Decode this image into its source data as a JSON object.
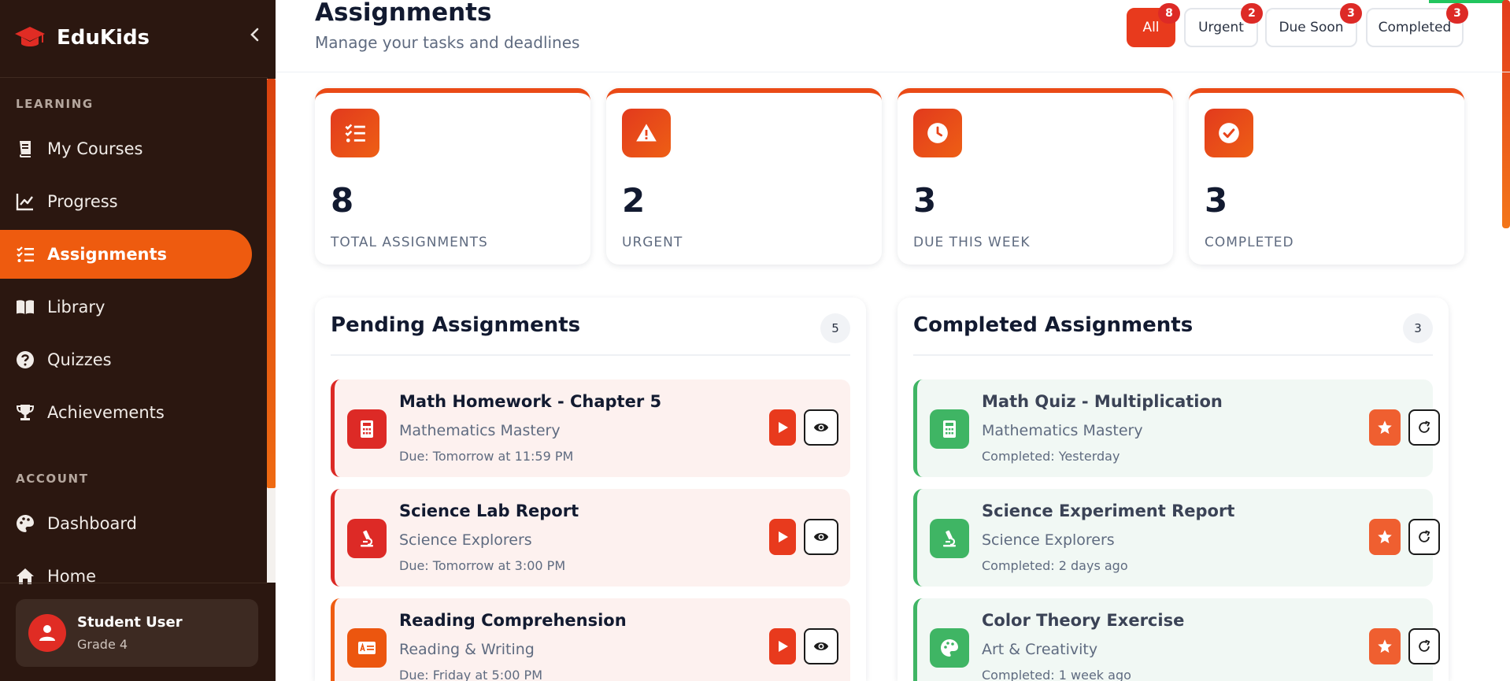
{
  "sidebar": {
    "brand": "EduKids",
    "sections": {
      "learning": "LEARNING",
      "account": "ACCOUNT"
    },
    "items": [
      {
        "label": "My Courses",
        "icon": "book-icon"
      },
      {
        "label": "Progress",
        "icon": "chart-line-icon"
      },
      {
        "label": "Assignments",
        "icon": "tasks-icon",
        "active": true
      },
      {
        "label": "Library",
        "icon": "open-book-icon"
      },
      {
        "label": "Quizzes",
        "icon": "question-circle-icon"
      },
      {
        "label": "Achievements",
        "icon": "trophy-icon"
      },
      {
        "label": "Dashboard",
        "icon": "palette-icon"
      },
      {
        "label": "Home",
        "icon": "home-icon"
      }
    ],
    "user": {
      "name": "Student User",
      "grade": "Grade 4"
    }
  },
  "header": {
    "title": "Assignments",
    "subtitle": "Manage your tasks and deadlines",
    "filters": [
      {
        "label": "All",
        "count": "8",
        "active": true
      },
      {
        "label": "Urgent",
        "count": "2"
      },
      {
        "label": "Due Soon",
        "count": "3"
      },
      {
        "label": "Completed",
        "count": "3"
      }
    ]
  },
  "stats": [
    {
      "value": "8",
      "label": "TOTAL ASSIGNMENTS",
      "icon": "tasks-icon"
    },
    {
      "value": "2",
      "label": "URGENT",
      "icon": "warning-icon"
    },
    {
      "value": "3",
      "label": "DUE THIS WEEK",
      "icon": "clock-icon"
    },
    {
      "value": "3",
      "label": "COMPLETED",
      "icon": "check-circle-icon"
    }
  ],
  "pending": {
    "title": "Pending Assignments",
    "count": "5",
    "items": [
      {
        "title": "Math Homework - Chapter 5",
        "course": "Mathematics Mastery",
        "due": "Due: Tomorrow at 11:59 PM",
        "icon": "calculator-icon"
      },
      {
        "title": "Science Lab Report",
        "course": "Science Explorers",
        "due": "Due: Tomorrow at 3:00 PM",
        "icon": "microscope-icon"
      },
      {
        "title": "Reading Comprehension",
        "course": "Reading & Writing",
        "due": "Due: Friday at 5:00 PM",
        "icon": "language-icon"
      }
    ]
  },
  "completed": {
    "title": "Completed Assignments",
    "count": "3",
    "items": [
      {
        "title": "Math Quiz - Multiplication",
        "course": "Mathematics Mastery",
        "done": "Completed: Yesterday",
        "icon": "calculator-icon"
      },
      {
        "title": "Science Experiment Report",
        "course": "Science Explorers",
        "done": "Completed: 2 days ago",
        "icon": "microscope-icon"
      },
      {
        "title": "Color Theory Exercise",
        "course": "Art & Creativity",
        "done": "Completed: 1 week ago",
        "icon": "palette-icon"
      }
    ]
  },
  "colors": {
    "accent": "#ee5b0f",
    "urgent": "#dc2a26",
    "success": "#3fb564",
    "sidebar": "#2b1710"
  }
}
